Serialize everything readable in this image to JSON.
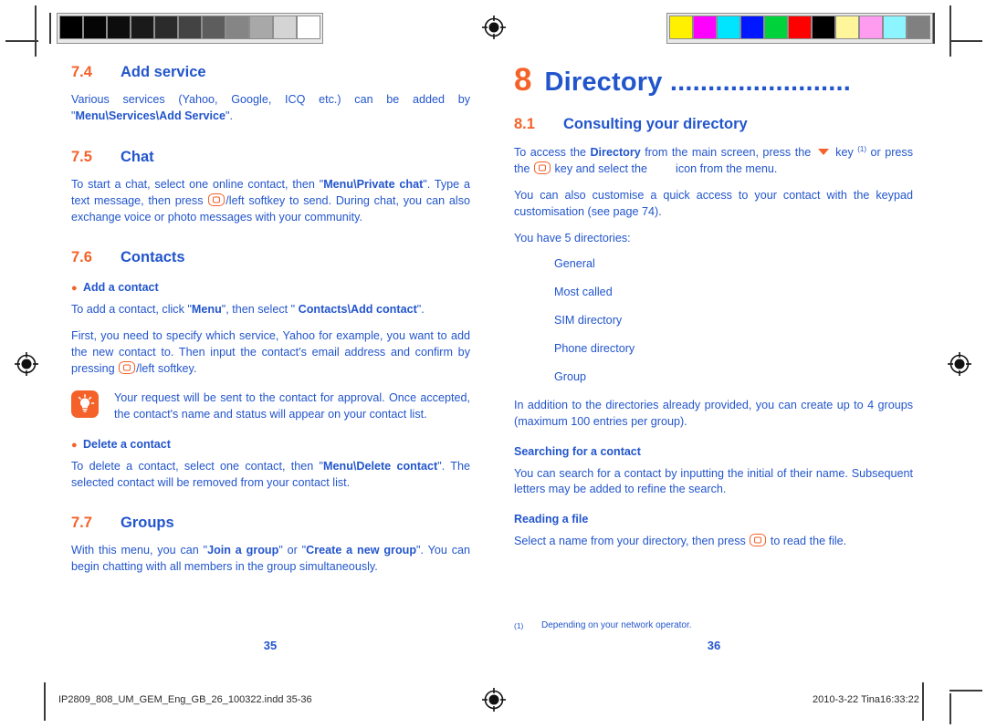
{
  "document": {
    "type": "print-proof-page",
    "colors": {
      "brand_orange": "#f4622a",
      "body_blue": "#2255cc",
      "slug_gray": "#2a2a2a"
    }
  },
  "calibration": {
    "gray_bar": {
      "name": "grayscale-calibration-bar",
      "patches": [
        "#000000",
        "#050505",
        "#0d0d0d",
        "#1a1a1a",
        "#2b2b2b",
        "#434343",
        "#5d5d5d",
        "#858585",
        "#a8a8a8",
        "#d4d4d4",
        "#ffffff"
      ]
    },
    "color_bar": {
      "name": "color-calibration-bar",
      "patches": [
        "#fff000",
        "#ff00ff",
        "#00e5ff",
        "#0018ff",
        "#00d23c",
        "#ff0000",
        "#000000",
        "#fff59a",
        "#ff9cf0",
        "#8df5ff",
        "#808080"
      ]
    }
  },
  "left_page": {
    "folio": "35",
    "sections": [
      {
        "number": "7.4",
        "title": "Add service",
        "paragraphs": [
          "Various services (Yahoo, Google, ICQ etc.) can be added by \"Menu\\Services\\Add Service\"."
        ]
      },
      {
        "number": "7.5",
        "title": "Chat"
      },
      {
        "number": "7.6",
        "title": "Contacts"
      },
      {
        "number": "7.7",
        "title": "Groups"
      }
    ],
    "chat": {
      "para1_a": "To start a chat, select one online contact, then \"",
      "para1_bold": "Menu\\Private chat",
      "para1_b": "\". Type a text message, then press ",
      "para1_c": "/left softkey to send. During chat, you can also exchange voice or photo messages with your community."
    },
    "add_contact": {
      "bullet_label": "Add a contact",
      "para1_a": "To add a contact, click \"",
      "para1_bold1": "Menu",
      "para1_b": "\", then select \" ",
      "para1_bold2": "Contacts\\Add contact",
      "para1_c": "\".",
      "para2_a": "First, you need to specify which service, Yahoo for example, you want to add the new contact to. Then input the contact's email address and confirm by pressing ",
      "para2_b": "/left softkey."
    },
    "tip": {
      "icon": "lightbulb-icon",
      "text": "Your request will be sent to the contact for approval. Once accepted, the contact's name and status will appear on your contact list."
    },
    "delete_contact": {
      "bullet_label": "Delete a contact",
      "para_a": "To delete a contact, select one contact, then \"",
      "para_bold": "Menu\\Delete contact",
      "para_b": "\". The selected contact will be removed from your contact list."
    },
    "groups": {
      "para_a": "With this menu, you can \"",
      "para_bold1": "Join a group",
      "para_b": "\" or \"",
      "para_bold2": "Create a new group",
      "para_c": "\". You can begin chatting with all members in the group simultaneously."
    }
  },
  "right_page": {
    "folio": "36",
    "chapter": {
      "number": "8",
      "title": "Directory",
      "dots": "........................"
    },
    "section": {
      "number": "8.1",
      "title": "Consulting your directory"
    },
    "access": {
      "para_a": "To access the ",
      "para_bold": "Directory",
      "para_b": " from the main screen, press the ",
      "para_c": " key ",
      "footnote_mark": "(1)",
      "para_d": " or press the ",
      "para_e": " key and select the ",
      "para_f": " icon from the menu."
    },
    "customise": "You can also customise a quick access to your contact with the keypad customisation (see page 74).",
    "directories_intro": "You have 5 directories:",
    "directories": [
      "General",
      "Most called",
      "SIM directory",
      "Phone directory",
      "Group"
    ],
    "groups_note": "In addition to the directories already provided, you can create up to 4 groups (maximum 100 entries per group).",
    "searching": {
      "heading": "Searching for a contact",
      "text": "You can search for a contact by inputting the initial of their name. Subsequent letters may be added to refine the search."
    },
    "reading": {
      "heading": "Reading a file",
      "text_a": "Select a name from your directory, then press ",
      "text_b": " to read the file."
    },
    "footnote": {
      "mark": "(1)",
      "text": "Depending on your network operator."
    }
  },
  "slug": {
    "left": "IP2809_808_UM_GEM_Eng_GB_26_100322.indd   35-36",
    "right": "2010-3-22   Tina16:33:22"
  }
}
